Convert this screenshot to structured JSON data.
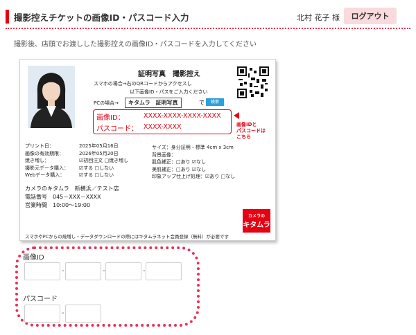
{
  "header": {
    "title": "撮影控えチケットの画像ID・パスコード入力",
    "user": "北村 花子 様",
    "logout_label": "ログアウト"
  },
  "description": "撮影後、店頭でお渡しした撮影控えの画像ID・パスコードを入力してください",
  "ticket": {
    "title": "証明写真　撮影控え",
    "smartphone_line1": "スマホの場合→右のQRコードからアクセスし",
    "smartphone_line2": "以下画像ID・パスをご入力ください",
    "pc_label": "PCの場合→",
    "pc_search_text": "キタムラ　証明写真",
    "pc_de": "で",
    "search_label": "検索",
    "image_id_label": "画像ID：",
    "image_id_value": "XXXX-XXXX-XXXX-XXXX",
    "passcode_label": "パスコード：",
    "passcode_value": "XXXX-XXXX",
    "arrow_note_1": "画像IDと",
    "arrow_note_2": "パスコードは",
    "arrow_note_3": "こちら",
    "left_info": [
      [
        "プリント日：",
        "2025年05月16日"
      ],
      [
        "画像の有効期限：",
        "2026年05月20日"
      ],
      [
        "焼き増し：",
        "☑初回注文 □焼き増し"
      ],
      [
        "撮影元データ購入：",
        "☑する □しない"
      ],
      [
        "Webデータ購入：",
        "☑する □しない"
      ]
    ],
    "right_info": [
      "サイズ：身分証明・標準 4cm x 3cm",
      "背景画像：",
      "肌色補正：□あり ☑なし",
      "美肌補正：□あり ☑なし",
      "印象アップ仕上げ処理：☑あり □なし"
    ],
    "store_name": "カメラのキタムラ　新横浜／テスト店",
    "store_phone": "電話番号　045－XXX－XXXX",
    "store_hours": "営業時間　10:00～19:00",
    "logo_small": "カメラの",
    "logo_large": "キタムラ",
    "footer_note": "スマホやPCからの焼増し・データダウンロードの際にはキタムラネット会員登録（無料）が必要です"
  },
  "form": {
    "image_id_label": "画像ID",
    "passcode_label": "パスコード",
    "separator": "-",
    "image_id_fields": [
      "",
      "",
      "",
      ""
    ],
    "passcode_fields": [
      "",
      ""
    ]
  },
  "colors": {
    "accent_red": "#e60012",
    "logout_bg": "#fadadd",
    "panel_border": "#ec2f58"
  }
}
